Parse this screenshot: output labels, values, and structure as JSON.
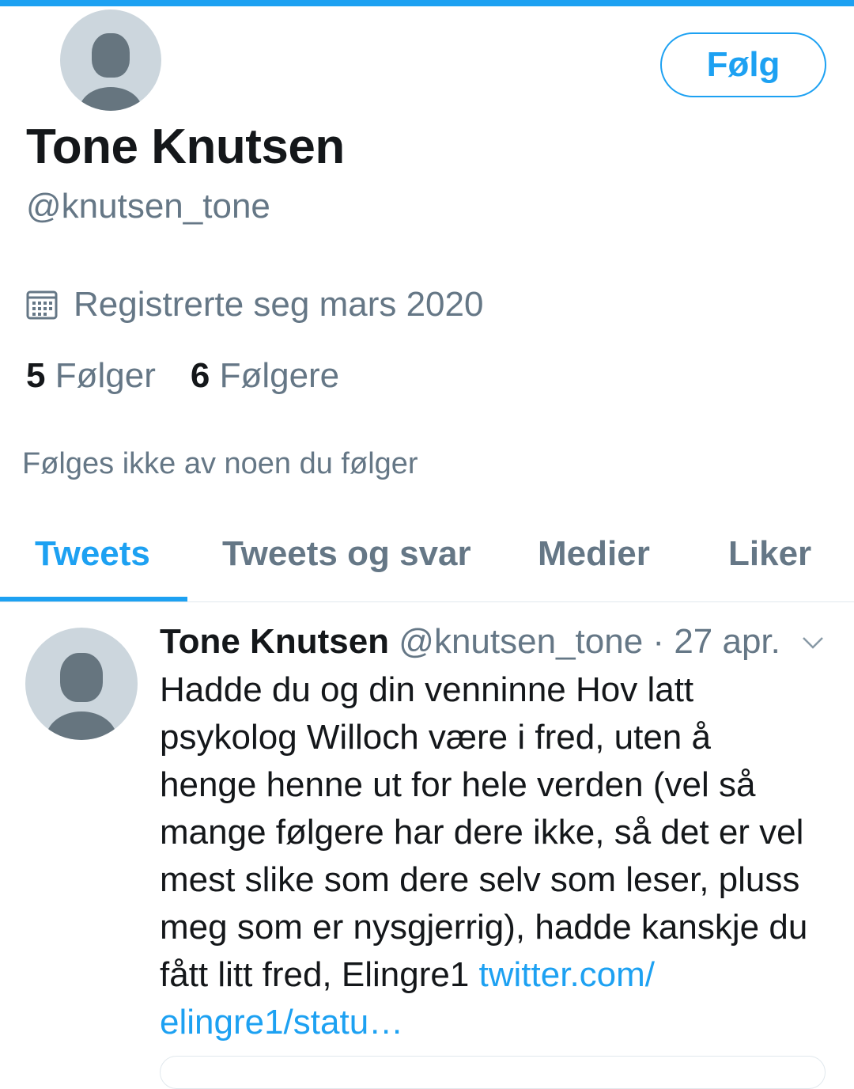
{
  "profile": {
    "name": "Tone Knutsen",
    "handle": "@knutsen_tone",
    "joined": "Registrerte seg mars 2020",
    "follow_label": "Følg",
    "following_count": "5",
    "following_label": "Følger",
    "followers_count": "6",
    "followers_label": "Følgere",
    "followed_by_note": "Følges ikke av noen du følger"
  },
  "tabs": [
    {
      "label": "Tweets",
      "active": true
    },
    {
      "label": "Tweets og svar",
      "active": false
    },
    {
      "label": "Medier",
      "active": false
    },
    {
      "label": "Liker",
      "active": false
    }
  ],
  "tweet": {
    "name": "Tone Knutsen",
    "handle": "@knutsen_tone",
    "separator": "·",
    "date": "27 apr.",
    "lines": [
      "Hadde du og din venninne Hov latt",
      "psykolog Willoch være i fred, uten å",
      "henge henne ut for hele verden (vel så",
      "mange følgere har dere ikke, så det er vel",
      "mest slike som dere selv som leser, pluss",
      "meg som er nysgjerrig), hadde kanskje du",
      "fått litt fred, Elingre1"
    ],
    "link_part1": "twitter.com/",
    "link_part2": "elingre1/statu…"
  },
  "colors": {
    "accent": "#1da1f2",
    "text": "#14171a",
    "muted": "#657786",
    "avatar_bg": "#ccd6dd",
    "avatar_fg": "#66757f",
    "divider": "#e1e8ed"
  },
  "icons": [
    "calendar-icon",
    "chevron-down-icon",
    "default-avatar-icon"
  ]
}
